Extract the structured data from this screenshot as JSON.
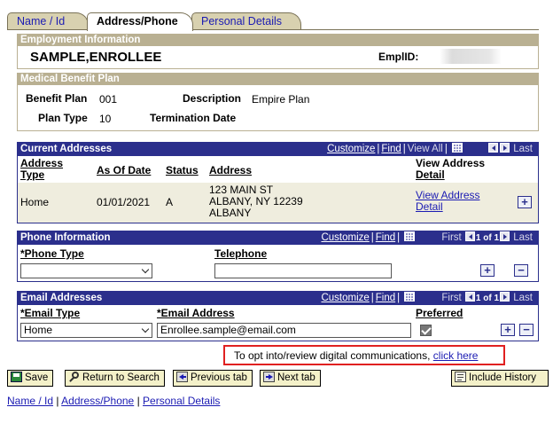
{
  "tabs": [
    {
      "label": "Name / Id",
      "active": false
    },
    {
      "label": "Address/Phone",
      "active": true
    },
    {
      "label": "Personal Details",
      "active": false
    }
  ],
  "employment": {
    "header": "Employment Information",
    "name": "SAMPLE,ENROLLEE",
    "emplid_label": "EmplID:",
    "emplid_value": ""
  },
  "medical": {
    "header": "Medical Benefit Plan",
    "benefit_plan_label": "Benefit Plan",
    "benefit_plan_value": "001",
    "description_label": "Description",
    "description_value": "Empire Plan",
    "plan_type_label": "Plan Type",
    "plan_type_value": "10",
    "termination_label": "Termination Date"
  },
  "addresses": {
    "header": "Current Addresses",
    "nav": {
      "customize": "Customize",
      "find": "Find",
      "view_all": "View All",
      "first": "",
      "last": "Last"
    },
    "columns": [
      "Address Type",
      "As Of Date",
      "Status",
      "Address",
      "View Address Detail"
    ],
    "col_address_type_1": "Address",
    "col_address_type_2": "Type",
    "col_view_1": "View Address",
    "col_view_2": "Detail",
    "row": {
      "type": "Home",
      "as_of": "01/01/2021",
      "status": "A",
      "address_line1": "123 MAIN ST",
      "address_line2": "ALBANY, NY 12239",
      "address_line3": "ALBANY",
      "view_link_1": "View Address",
      "view_link_2": "Detail"
    }
  },
  "phone": {
    "header": "Phone Information",
    "nav": {
      "customize": "Customize",
      "find": "Find",
      "first": "First",
      "count": "1 of 1",
      "last": "Last"
    },
    "phone_type_label": "*Phone Type",
    "telephone_label": "Telephone",
    "phone_type_value": "",
    "telephone_value": ""
  },
  "email": {
    "header": "Email Addresses",
    "nav": {
      "customize": "Customize",
      "find": "Find",
      "first": "First",
      "count": "1 of 1",
      "last": "Last"
    },
    "email_type_label": "*Email Type",
    "email_address_label": "*Email Address",
    "preferred_label": "Preferred",
    "email_type_value": "Home",
    "email_address_value": "Enrollee.sample@email.com",
    "preferred_checked": true
  },
  "optin": {
    "text": "To opt into/review digital communications,",
    "link": "click here"
  },
  "buttons": {
    "save": "Save",
    "return_to_search": "Return to Search",
    "previous_tab": "Previous tab",
    "next_tab": "Next tab",
    "include_history": "Include History"
  },
  "footer_links": {
    "name_id": "Name / Id",
    "address_phone": "Address/Phone",
    "personal_details": "Personal Details",
    "separator": "|"
  },
  "colors": {
    "tan": "#b9b092",
    "grid_blue": "#2b2f8c",
    "link": "#1b1bb3",
    "button_bg": "#f4f1c9",
    "highlight": "#e02020"
  }
}
